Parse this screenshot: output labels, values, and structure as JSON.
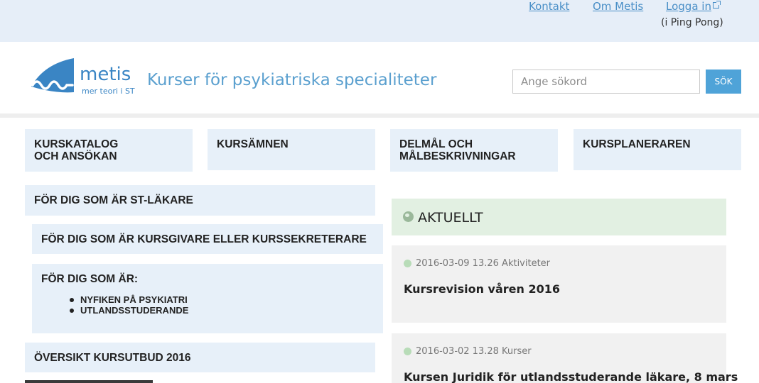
{
  "topbar": {
    "links": [
      "Kontakt",
      "Om Metis",
      "Logga in"
    ],
    "login_note": "(i Ping Pong)"
  },
  "header": {
    "logo_word": "metis",
    "logo_tagline": "mer teori i ST",
    "site_title": "Kurser för psykiatriska specialiteter",
    "search_placeholder": "Ange sökord",
    "search_button": "SÖK"
  },
  "nav": [
    {
      "label_line1": "KURSKATALOG",
      "label_line2": "OCH ANSÖKAN"
    },
    {
      "label_line1": "KURSÄMNEN",
      "label_line2": ""
    },
    {
      "label_line1": "DELMÅL OCH",
      "label_line2": "MÅLBESKRIVNINGAR"
    },
    {
      "label_line1": "KURSPLANERAREN",
      "label_line2": ""
    }
  ],
  "left_panels": {
    "st_doctor": "FÖR DIG SOM ÄR ST-LÄKARE",
    "course_giver": "FÖR DIG SOM ÄR KURSGIVARE ELLER KURSSEKRETERARE",
    "other": {
      "title": "FÖR DIG SOM ÄR:",
      "items": [
        "NYFIKEN PÅ PSYKIATRI",
        "UTLANDSSTUDERANDE"
      ]
    },
    "overview": "ÖVERSIKT KURSUTBUD 2016"
  },
  "news": {
    "title": "AKTUELLT",
    "items": [
      {
        "date": "2016-03-09 13.26",
        "category": "Aktiviteter",
        "headline": "Kursrevision våren 2016"
      },
      {
        "date": "2016-03-02 13.28",
        "category": "Kurser",
        "headline": "Kursen Juridik för utlandsstuderande läkare, 8 mars"
      }
    ]
  },
  "colors": {
    "topbar_bg": "#e6eef8",
    "link": "#4a8fc7",
    "tile_bg": "#e7f0f9",
    "news_header_bg": "#e2f0e2",
    "button": "#4fa3d8"
  }
}
